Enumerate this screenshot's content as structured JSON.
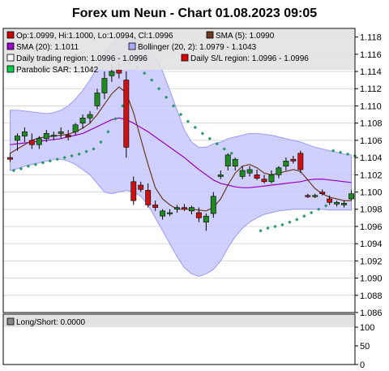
{
  "chart_data": [
    {
      "type": "candlestick",
      "title": "Forex um Neun - Chart 01.08.2023 09:05",
      "ylim": [
        1.086,
        1.119
      ],
      "y_ticks": [
        "1.086",
        "1.088",
        "1.090",
        "1.092",
        "1.094",
        "1.096",
        "1.098",
        "1.100",
        "1.102",
        "1.104",
        "1.106",
        "1.108",
        "1.110",
        "1.112",
        "1.114",
        "1.116",
        "1.118"
      ],
      "legend": [
        {
          "label": "Op:1.0999, Hi:1.1000, Lo:1.0994, Cl:1.0996",
          "color": "#cc0000"
        },
        {
          "label": "SMA (5): 1.0990",
          "color": "#6b3a1f"
        },
        {
          "label": "SMA (20): 1.1011",
          "color": "#9900cc"
        },
        {
          "label": "Bollinger (20, 2): 1.0979 - 1.1043",
          "color": "#aaaaff"
        },
        {
          "label": "Daily trading region: 1.0996 - 1.0996",
          "color": "#ffffff"
        },
        {
          "label": "Daily S/L region: 1.0996 - 1.0996",
          "color": "#dd0000"
        },
        {
          "label": "Parabolic SAR: 1.1042",
          "color": "#00cc44"
        }
      ],
      "candles": [
        {
          "o": 1.104,
          "h": 1.1045,
          "l": 1.1035,
          "c": 1.1038
        },
        {
          "o": 1.106,
          "h": 1.1068,
          "l": 1.1048,
          "c": 1.1065
        },
        {
          "o": 1.1065,
          "h": 1.1075,
          "l": 1.1058,
          "c": 1.107
        },
        {
          "o": 1.106,
          "h": 1.1068,
          "l": 1.105,
          "c": 1.1055
        },
        {
          "o": 1.1055,
          "h": 1.1065,
          "l": 1.105,
          "c": 1.1062
        },
        {
          "o": 1.1062,
          "h": 1.1072,
          "l": 1.1058,
          "c": 1.1068
        },
        {
          "o": 1.1065,
          "h": 1.107,
          "l": 1.106,
          "c": 1.1066
        },
        {
          "o": 1.1068,
          "h": 1.1075,
          "l": 1.1062,
          "c": 1.107
        },
        {
          "o": 1.1066,
          "h": 1.1072,
          "l": 1.106,
          "c": 1.1064
        },
        {
          "o": 1.107,
          "h": 1.108,
          "l": 1.1066,
          "c": 1.1078
        },
        {
          "o": 1.108,
          "h": 1.109,
          "l": 1.1074,
          "c": 1.1086
        },
        {
          "o": 1.1086,
          "h": 1.1094,
          "l": 1.108,
          "c": 1.109
        },
        {
          "o": 1.11,
          "h": 1.112,
          "l": 1.1096,
          "c": 1.1115
        },
        {
          "o": 1.1115,
          "h": 1.114,
          "l": 1.1108,
          "c": 1.1132
        },
        {
          "o": 1.1135,
          "h": 1.1148,
          "l": 1.1128,
          "c": 1.114
        },
        {
          "o": 1.1142,
          "h": 1.115,
          "l": 1.1132,
          "c": 1.1138
        },
        {
          "o": 1.113,
          "h": 1.114,
          "l": 1.104,
          "c": 1.1052
        },
        {
          "o": 1.1012,
          "h": 1.1018,
          "l": 1.0985,
          "c": 1.099
        },
        {
          "o": 1.1008,
          "h": 1.1012,
          "l": 1.1,
          "c": 1.1003
        },
        {
          "o": 1.1002,
          "h": 1.101,
          "l": 1.0982,
          "c": 1.0985
        },
        {
          "o": 1.0985,
          "h": 1.099,
          "l": 1.0978,
          "c": 1.0982
        },
        {
          "o": 1.0972,
          "h": 1.098,
          "l": 1.0968,
          "c": 1.0978
        },
        {
          "o": 1.0976,
          "h": 1.098,
          "l": 1.0972,
          "c": 1.0976
        },
        {
          "o": 1.098,
          "h": 1.0985,
          "l": 1.0976,
          "c": 1.0982
        },
        {
          "o": 1.0982,
          "h": 1.0986,
          "l": 1.0978,
          "c": 1.098
        },
        {
          "o": 1.0978,
          "h": 1.0984,
          "l": 1.0974,
          "c": 1.0982
        },
        {
          "o": 1.0976,
          "h": 1.0982,
          "l": 1.0965,
          "c": 1.097
        },
        {
          "o": 1.0965,
          "h": 1.0975,
          "l": 1.0955,
          "c": 1.0972
        },
        {
          "o": 1.0975,
          "h": 1.1,
          "l": 1.097,
          "c": 1.0995
        },
        {
          "o": 1.1018,
          "h": 1.1025,
          "l": 1.1015,
          "c": 1.102
        },
        {
          "o": 1.103,
          "h": 1.1045,
          "l": 1.1025,
          "c": 1.1043
        },
        {
          "o": 1.103,
          "h": 1.104,
          "l": 1.1025,
          "c": 1.1038
        },
        {
          "o": 1.1018,
          "h": 1.103,
          "l": 1.1015,
          "c": 1.1025
        },
        {
          "o": 1.1022,
          "h": 1.103,
          "l": 1.1018,
          "c": 1.1026
        },
        {
          "o": 1.102,
          "h": 1.1026,
          "l": 1.1014,
          "c": 1.1016
        },
        {
          "o": 1.1015,
          "h": 1.102,
          "l": 1.101,
          "c": 1.1012
        },
        {
          "o": 1.1012,
          "h": 1.1025,
          "l": 1.101,
          "c": 1.102
        },
        {
          "o": 1.102,
          "h": 1.103,
          "l": 1.1016,
          "c": 1.1028
        },
        {
          "o": 1.103,
          "h": 1.104,
          "l": 1.1025,
          "c": 1.1036
        },
        {
          "o": 1.1038,
          "h": 1.1042,
          "l": 1.1033,
          "c": 1.1036
        },
        {
          "o": 1.1045,
          "h": 1.1048,
          "l": 1.1022,
          "c": 1.1026
        },
        {
          "o": 1.0996,
          "h": 1.0998,
          "l": 1.0993,
          "c": 1.0995
        },
        {
          "o": 1.0996,
          "h": 1.0998,
          "l": 1.0993,
          "c": 1.0996
        },
        {
          "o": 1.1,
          "h": 1.1003,
          "l": 1.0996,
          "c": 1.0998
        },
        {
          "o": 1.0992,
          "h": 1.0996,
          "l": 1.0985,
          "c": 1.0988
        },
        {
          "o": 1.0986,
          "h": 1.099,
          "l": 1.0983,
          "c": 1.0988
        },
        {
          "o": 1.0985,
          "h": 1.099,
          "l": 1.0982,
          "c": 1.0987
        },
        {
          "o": 1.0992,
          "h": 1.1002,
          "l": 1.099,
          "c": 1.0998
        }
      ],
      "sma5": [
        1.1045,
        1.105,
        1.1055,
        1.106,
        1.1063,
        1.1064,
        1.1065,
        1.1066,
        1.1067,
        1.107,
        1.1074,
        1.108,
        1.109,
        1.1102,
        1.1114,
        1.1122,
        1.1115,
        1.1092,
        1.1062,
        1.1032,
        1.1005,
        1.0992,
        1.0985,
        1.098,
        1.098,
        1.098,
        1.0979,
        1.0978,
        1.0982,
        1.0992,
        1.1008,
        1.1022,
        1.103,
        1.1032,
        1.1028,
        1.1022,
        1.102,
        1.1022,
        1.1024,
        1.1026,
        1.1024,
        1.1014,
        1.1004,
        1.0998,
        1.0994,
        1.0992,
        1.099,
        1.099
      ],
      "sma20": [
        1.1055,
        1.1056,
        1.1057,
        1.1058,
        1.1059,
        1.106,
        1.1061,
        1.1062,
        1.1064,
        1.1066,
        1.1068,
        1.1072,
        1.1076,
        1.108,
        1.1084,
        1.1086,
        1.1084,
        1.108,
        1.1075,
        1.107,
        1.1064,
        1.1058,
        1.1052,
        1.1046,
        1.104,
        1.1033,
        1.1026,
        1.102,
        1.1014,
        1.101,
        1.1008,
        1.1006,
        1.1005,
        1.1005,
        1.1006,
        1.1007,
        1.1008,
        1.1009,
        1.101,
        1.1011,
        1.1012,
        1.1014,
        1.1015,
        1.1015,
        1.1014,
        1.1013,
        1.1012,
        1.1011
      ],
      "boll_upper": [
        1.1095,
        1.1095,
        1.1094,
        1.1093,
        1.1092,
        1.1091,
        1.1092,
        1.1095,
        1.11,
        1.1108,
        1.1118,
        1.113,
        1.1145,
        1.116,
        1.1172,
        1.118,
        1.1182,
        1.118,
        1.1175,
        1.1168,
        1.1158,
        1.114,
        1.1118,
        1.1095,
        1.1072,
        1.1058,
        1.1052,
        1.1052,
        1.1056,
        1.1058,
        1.1062,
        1.1064,
        1.1066,
        1.1068,
        1.1068,
        1.1067,
        1.1066,
        1.1064,
        1.1062,
        1.106,
        1.1058,
        1.1055,
        1.1052,
        1.105,
        1.1048,
        1.1046,
        1.1044,
        1.1043
      ],
      "boll_lower": [
        1.1025,
        1.1027,
        1.103,
        1.1032,
        1.1034,
        1.1036,
        1.1038,
        1.1038,
        1.1036,
        1.1032,
        1.1026,
        1.102,
        1.101,
        1.1,
        1.0998,
        1.1,
        1.1002,
        1.1,
        1.0995,
        1.0985,
        1.097,
        1.0955,
        1.094,
        1.0925,
        1.0912,
        1.0905,
        1.0902,
        1.0905,
        1.091,
        1.092,
        1.0935,
        1.0948,
        1.0958,
        1.0965,
        1.097,
        1.0974,
        1.0976,
        1.0978,
        1.0979,
        1.098,
        1.098,
        1.098,
        1.098,
        1.098,
        1.0979,
        1.0979,
        1.0979,
        1.0979
      ],
      "sar": [
        null,
        1.1025,
        1.1027,
        1.103,
        1.1032,
        1.1034,
        1.1036,
        1.1038,
        1.104,
        1.1042,
        1.1044,
        1.1047,
        1.105,
        1.1058,
        1.107,
        1.1085,
        1.11,
        1.115,
        1.1145,
        1.1138,
        1.113,
        1.112,
        1.111,
        1.11,
        1.109,
        1.1082,
        1.1075,
        1.1068,
        1.1062,
        1.1056,
        1.105,
        1.1045,
        null,
        null,
        null,
        1.0955,
        1.0958,
        1.096,
        1.0962,
        1.0965,
        1.0968,
        1.0972,
        1.0976,
        1.098,
        1.0984,
        1.1048,
        1.1046,
        1.1044,
        1.1042
      ]
    },
    {
      "type": "indicator",
      "legend": [
        {
          "label": "Long/Short: 0.0000",
          "color": "#888888"
        }
      ],
      "ylim": [
        0,
        100
      ],
      "y_ticks": [
        "0",
        "50",
        "100"
      ],
      "values": [
        0
      ]
    }
  ]
}
